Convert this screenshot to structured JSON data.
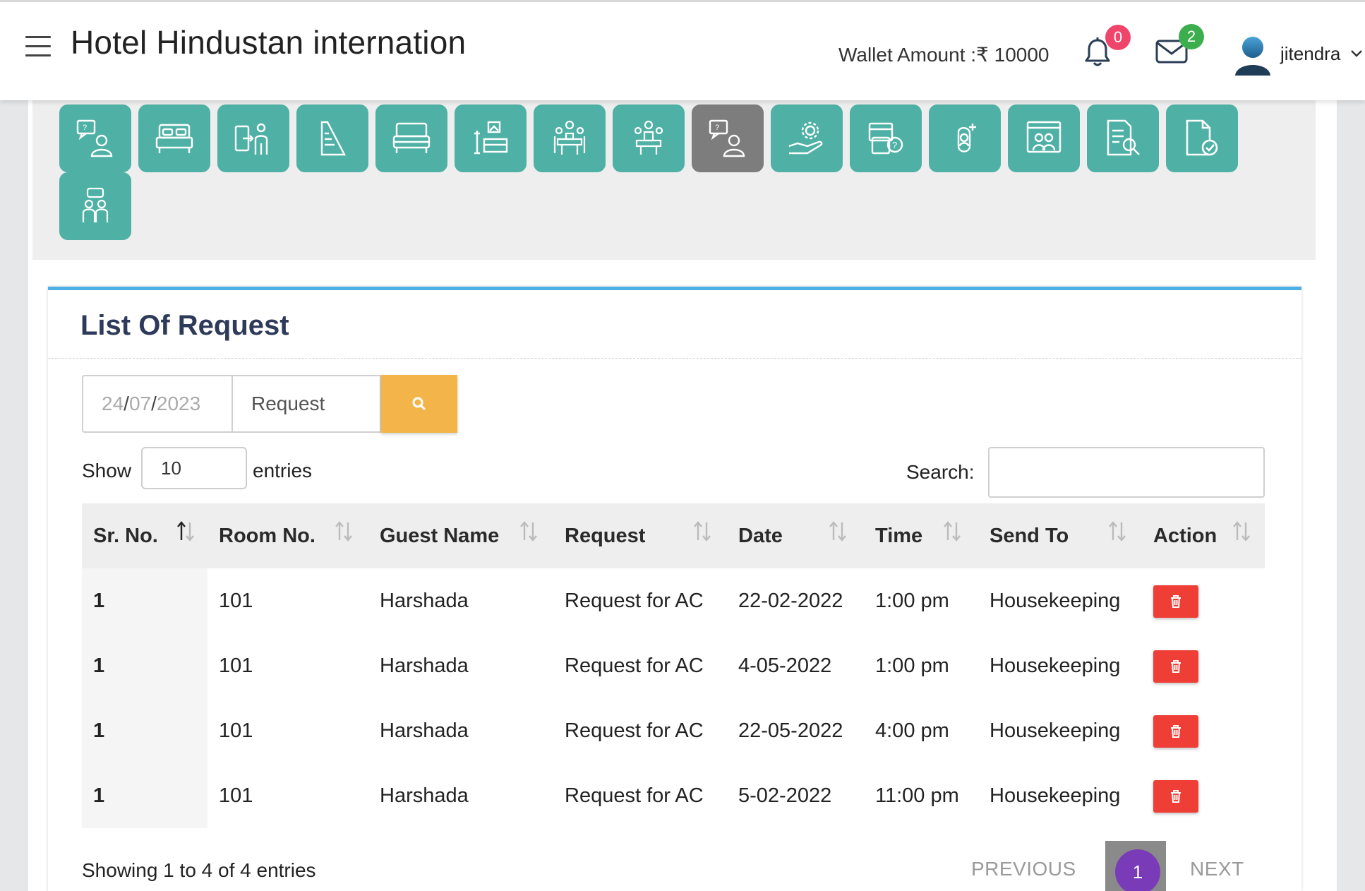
{
  "header": {
    "title": "Hotel Hindustan internation",
    "wallet_label": "Wallet Amount :₹ 10000",
    "notification_count": "0",
    "message_count": "2",
    "username": "jitendra"
  },
  "toolbar_icons": [
    "guest-request-icon",
    "room-bed-icon",
    "check-in-icon",
    "blueprint-icon",
    "room-bed-2-icon",
    "room-interior-icon",
    "meeting-icon",
    "conference-icon",
    "guest-request-active-icon",
    "service-settings-icon",
    "payment-help-icon",
    "add-guest-icon",
    "guest-board-icon",
    "report-search-icon",
    "document-check-icon",
    "staff-chat-icon"
  ],
  "card": {
    "title": "List Of Request",
    "date_filter": {
      "day": "24",
      "sep1": "/",
      "month": "07",
      "sep2": "/",
      "year": "2023"
    },
    "request_select": "Request"
  },
  "table_controls": {
    "show_label": "Show",
    "page_size": "10",
    "entries_label": "entries",
    "search_label": "Search:"
  },
  "table": {
    "columns": [
      "Sr. No.",
      "Room No.",
      "Guest Name",
      "Request",
      "Date",
      "Time",
      "Send To",
      "Action"
    ],
    "rows": [
      {
        "sr": "1",
        "room": "101",
        "guest": "Harshada",
        "request": "Request for AC",
        "date": "22-02-2022",
        "time": "1:00 pm",
        "send_to": "Housekeeping"
      },
      {
        "sr": "1",
        "room": "101",
        "guest": "Harshada",
        "request": "Request for AC",
        "date": "4-05-2022",
        "time": "1:00 pm",
        "send_to": "Housekeeping"
      },
      {
        "sr": "1",
        "room": "101",
        "guest": "Harshada",
        "request": "Request for AC",
        "date": "22-05-2022",
        "time": "4:00 pm",
        "send_to": "Housekeeping"
      },
      {
        "sr": "1",
        "room": "101",
        "guest": "Harshada",
        "request": "Request for AC",
        "date": "5-02-2022",
        "time": "11:00 pm",
        "send_to": "Housekeeping"
      }
    ]
  },
  "footer": {
    "showing": "Showing 1 to 4 of 4 entries",
    "previous": "PREVIOUS",
    "page": "1",
    "next": "NEXT"
  },
  "colors": {
    "tile": "#4fb1a5",
    "tile_active": "#7d7d7d",
    "search_button": "#f3b54a",
    "delete_button": "#ef3e36",
    "card_accent": "#4eaee6",
    "page_active": "#7a3bb8"
  }
}
